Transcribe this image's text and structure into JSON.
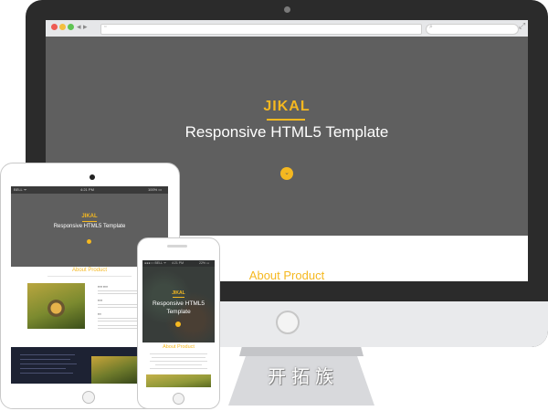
{
  "site": {
    "brand": "JIKAL",
    "tagline": "Responsive HTML5 Template",
    "about_heading": "About Product",
    "about_heading_alt": "About Product"
  },
  "stand_label": "开拓族",
  "tablet": {
    "carrier": "BELL ᯤ",
    "time": "4:21 PM",
    "battery": "100% ▭",
    "tagline_small": "Responsive HTML5 Template"
  },
  "phone": {
    "carrier": "●●●○○ BELL ᯤ",
    "time": "4:21 PM",
    "battery": "22% ▭",
    "tagline_lines": "Responsive HTML5 Template"
  },
  "colors": {
    "accent": "#f5b820",
    "hero_bg": "#5f5f5f",
    "bezel": "#2b2b2b",
    "dark_section": "#1d2233"
  },
  "icons": {
    "traffic_lights": [
      "#ee5b53",
      "#f4bf40",
      "#5fc453"
    ],
    "nav": "back-forward-icon",
    "expand": "expand-icon",
    "search": "search-icon"
  }
}
